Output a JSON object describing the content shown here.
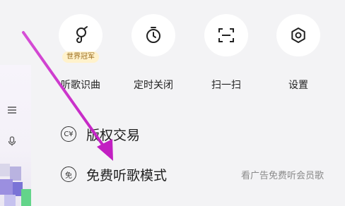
{
  "quick_actions": [
    {
      "label": "听歌识曲",
      "icon": "music-recognition-icon",
      "badge": "世界冠军"
    },
    {
      "label": "定时关闭",
      "icon": "timer-icon"
    },
    {
      "label": "扫一扫",
      "icon": "scan-icon"
    },
    {
      "label": "设置",
      "icon": "gear-icon"
    }
  ],
  "menu": [
    {
      "title": "版权交易",
      "icon_glyph": "C¥",
      "icon": "copyright-trade-icon",
      "hint": ""
    },
    {
      "title": "免费听歌模式",
      "icon_glyph": "免",
      "icon": "free-mode-icon",
      "hint": "看广告免费听会员歌"
    }
  ],
  "colors": {
    "background": "#f3f3f5",
    "badge_bg": "#fff2cc",
    "badge_text": "#9a6b1b",
    "annotation_arrow": "#cc33cc"
  }
}
